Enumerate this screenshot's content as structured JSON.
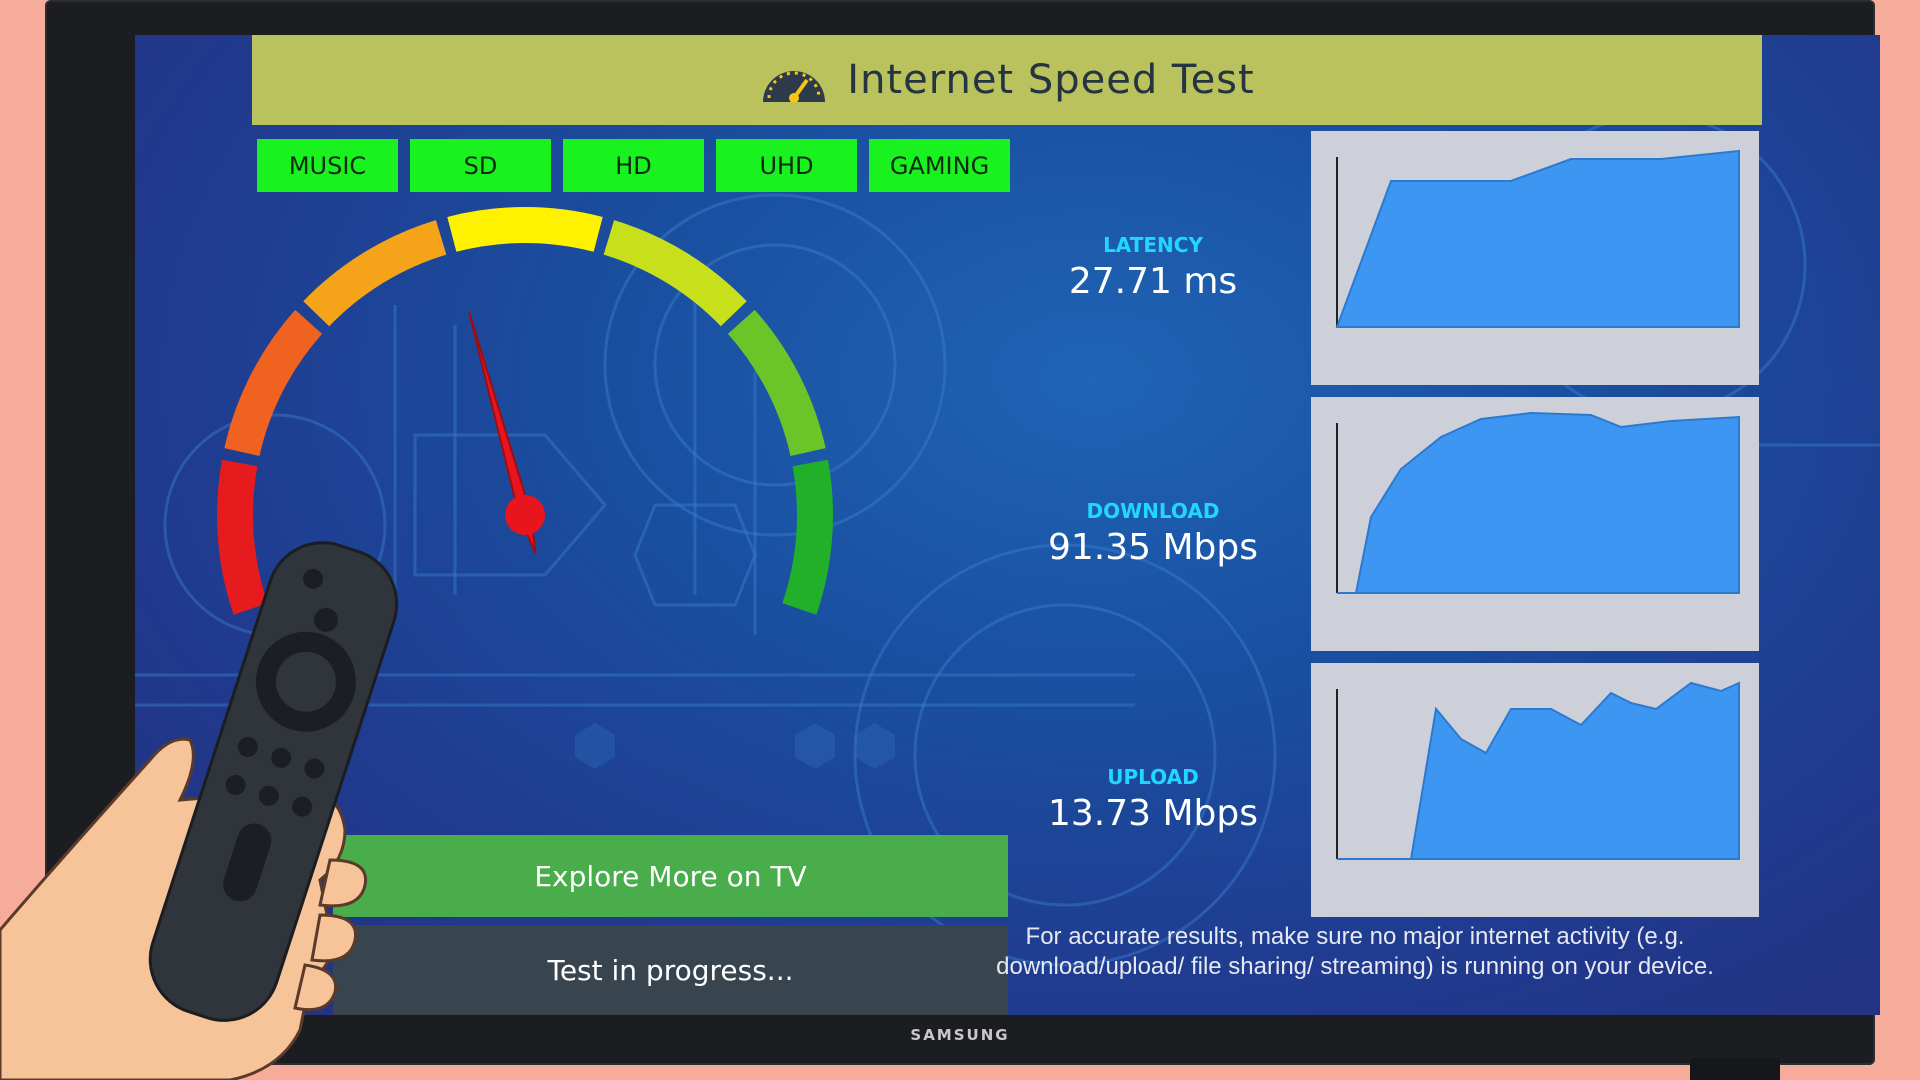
{
  "header": {
    "title": "Internet Speed Test",
    "logo_icon": "speedometer-icon"
  },
  "categories": [
    {
      "label": "MUSIC"
    },
    {
      "label": "SD"
    },
    {
      "label": "HD"
    },
    {
      "label": "UHD"
    },
    {
      "label": "GAMING"
    }
  ],
  "gauge": {
    "needle_level": 0.43,
    "segment_colors": [
      "#e61b1d",
      "#f0621f",
      "#f5a41a",
      "#fff200",
      "#c8e01b",
      "#6cc528",
      "#22b02a"
    ]
  },
  "stats": {
    "latency": {
      "label": "LATENCY",
      "value": "27.71 ms"
    },
    "download": {
      "label": "DOWNLOAD",
      "value": "91.35 Mbps"
    },
    "upload": {
      "label": "UPLOAD",
      "value": "13.73 Mbps"
    }
  },
  "actions": {
    "explore_label": "Explore More on TV",
    "status_text": "Test in progress..."
  },
  "note": "For accurate results, make sure no major internet activity (e.g. download/upload/ file sharing/ streaming) is running on your device.",
  "tv": {
    "brand": "SAMSUNG"
  },
  "colors": {
    "accent_green": "#19f21f",
    "title_bar": "#b9c25c",
    "graph_fill": "#3d97f2",
    "label_cyan": "#22d7ff"
  }
}
